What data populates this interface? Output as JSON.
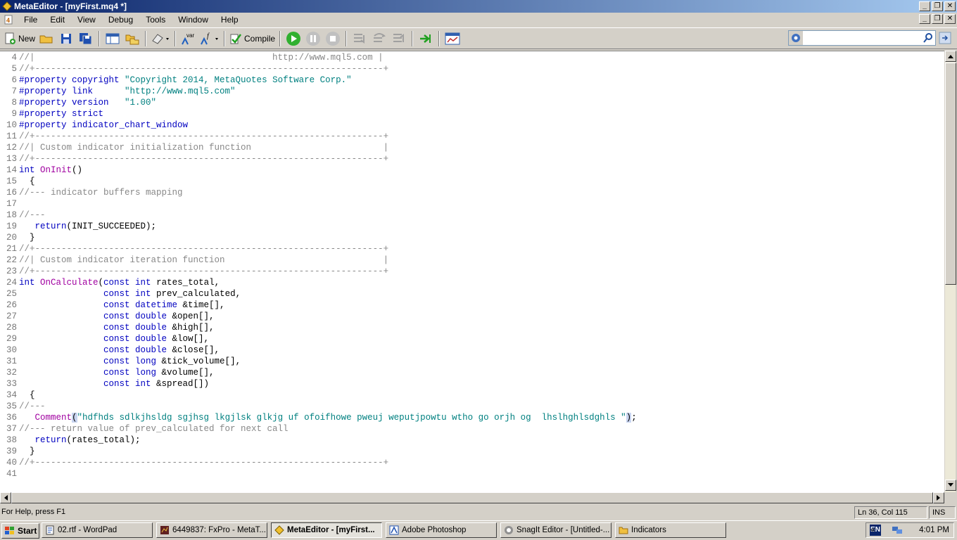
{
  "window": {
    "title": "MetaEditor - [myFirst.mq4 *]"
  },
  "menu": [
    "File",
    "Edit",
    "View",
    "Debug",
    "Tools",
    "Window",
    "Help"
  ],
  "toolbar": {
    "new_label": "New",
    "compile_label": "Compile",
    "var_label": "var",
    "search_value": ""
  },
  "editor": {
    "lines": [
      {
        "n": "4",
        "t": [
          [
            "cm",
            "//|                                             http://www.mql5.com |"
          ]
        ]
      },
      {
        "n": "5",
        "t": [
          [
            "cm",
            "//+------------------------------------------------------------------+"
          ]
        ]
      },
      {
        "n": "6",
        "t": [
          [
            "kw",
            "#property copyright "
          ],
          [
            "str",
            "\"Copyright 2014, MetaQuotes Software Corp.\""
          ]
        ]
      },
      {
        "n": "7",
        "t": [
          [
            "kw",
            "#property link      "
          ],
          [
            "str",
            "\"http://www.mql5.com\""
          ]
        ]
      },
      {
        "n": "8",
        "t": [
          [
            "kw",
            "#property version   "
          ],
          [
            "str",
            "\"1.00\""
          ]
        ]
      },
      {
        "n": "9",
        "t": [
          [
            "kw",
            "#property strict"
          ]
        ]
      },
      {
        "n": "10",
        "t": [
          [
            "kw",
            "#property indicator_chart_window"
          ]
        ]
      },
      {
        "n": "11",
        "t": [
          [
            "cm",
            "//+------------------------------------------------------------------+"
          ]
        ]
      },
      {
        "n": "12",
        "t": [
          [
            "cm",
            "//| Custom indicator initialization function                         |"
          ]
        ]
      },
      {
        "n": "13",
        "t": [
          [
            "cm",
            "//+------------------------------------------------------------------+"
          ]
        ]
      },
      {
        "n": "14",
        "t": [
          [
            "kw",
            "int "
          ],
          [
            "fn",
            "OnInit"
          ],
          [
            "tx",
            "()"
          ]
        ]
      },
      {
        "n": "15",
        "t": [
          [
            "tx",
            "  {"
          ]
        ]
      },
      {
        "n": "16",
        "t": [
          [
            "cm",
            "//--- indicator buffers mapping"
          ]
        ]
      },
      {
        "n": "17",
        "t": [
          [
            "tx",
            ""
          ]
        ]
      },
      {
        "n": "18",
        "t": [
          [
            "cm",
            "//---"
          ]
        ]
      },
      {
        "n": "19",
        "t": [
          [
            "kw",
            "   return"
          ],
          [
            "tx",
            "(INIT_SUCCEEDED);"
          ]
        ]
      },
      {
        "n": "20",
        "t": [
          [
            "tx",
            "  }"
          ]
        ]
      },
      {
        "n": "21",
        "t": [
          [
            "cm",
            "//+------------------------------------------------------------------+"
          ]
        ]
      },
      {
        "n": "22",
        "t": [
          [
            "cm",
            "//| Custom indicator iteration function                              |"
          ]
        ]
      },
      {
        "n": "23",
        "t": [
          [
            "cm",
            "//+------------------------------------------------------------------+"
          ]
        ]
      },
      {
        "n": "24",
        "t": [
          [
            "kw",
            "int "
          ],
          [
            "fn",
            "OnCalculate"
          ],
          [
            "tx",
            "("
          ],
          [
            "kw",
            "const int "
          ],
          [
            "tx",
            "rates_total,"
          ]
        ]
      },
      {
        "n": "25",
        "t": [
          [
            "kw",
            "                const int "
          ],
          [
            "tx",
            "prev_calculated,"
          ]
        ]
      },
      {
        "n": "26",
        "t": [
          [
            "kw",
            "                const datetime "
          ],
          [
            "tx",
            "&time[],"
          ]
        ]
      },
      {
        "n": "27",
        "t": [
          [
            "kw",
            "                const double "
          ],
          [
            "tx",
            "&open[],"
          ]
        ]
      },
      {
        "n": "28",
        "t": [
          [
            "kw",
            "                const double "
          ],
          [
            "tx",
            "&high[],"
          ]
        ]
      },
      {
        "n": "29",
        "t": [
          [
            "kw",
            "                const double "
          ],
          [
            "tx",
            "&low[],"
          ]
        ]
      },
      {
        "n": "30",
        "t": [
          [
            "kw",
            "                const double "
          ],
          [
            "tx",
            "&close[],"
          ]
        ]
      },
      {
        "n": "31",
        "t": [
          [
            "kw",
            "                const long "
          ],
          [
            "tx",
            "&tick_volume[],"
          ]
        ]
      },
      {
        "n": "32",
        "t": [
          [
            "kw",
            "                const long "
          ],
          [
            "tx",
            "&volume[],"
          ]
        ]
      },
      {
        "n": "33",
        "t": [
          [
            "kw",
            "                const int "
          ],
          [
            "tx",
            "&spread[])"
          ]
        ]
      },
      {
        "n": "34",
        "t": [
          [
            "tx",
            "  {"
          ]
        ]
      },
      {
        "n": "35",
        "t": [
          [
            "cm",
            "//---"
          ]
        ]
      },
      {
        "n": "36",
        "t": [
          [
            "fn",
            "   Comment"
          ],
          [
            "hl",
            "("
          ],
          [
            "str",
            "\"hdfhds sdlkjhsldg sgjhsg lkgjlsk glkjg uf ofoifhowe pweuj weputjpowtu wtho go orjh og  lhslhghlsdghls \""
          ],
          [
            "hl",
            ")"
          ],
          [
            "tx",
            ";"
          ]
        ]
      },
      {
        "n": "37",
        "t": [
          [
            "cm",
            "//--- return value of prev_calculated for next call"
          ]
        ]
      },
      {
        "n": "38",
        "t": [
          [
            "kw",
            "   return"
          ],
          [
            "tx",
            "(rates_total);"
          ]
        ]
      },
      {
        "n": "39",
        "t": [
          [
            "tx",
            "  }"
          ]
        ]
      },
      {
        "n": "40",
        "t": [
          [
            "cm",
            "//+------------------------------------------------------------------+"
          ]
        ]
      },
      {
        "n": "41",
        "t": [
          [
            "tx",
            ""
          ]
        ]
      }
    ]
  },
  "status": {
    "help": "For Help, press F1",
    "position": "Ln 36, Col 115",
    "mode": "INS"
  },
  "taskbar": {
    "start_label": "Start",
    "tasks": [
      {
        "label": "02.rtf - WordPad",
        "active": false
      },
      {
        "label": "6449837: FxPro - MetaT...",
        "active": false
      },
      {
        "label": "MetaEditor - [myFirst...",
        "active": true
      },
      {
        "label": "Adobe Photoshop",
        "active": false
      },
      {
        "label": "SnagIt Editor - [Untitled-...",
        "active": false
      },
      {
        "label": "Indicators",
        "active": false
      }
    ],
    "language": "EN",
    "clock": "4:01 PM"
  }
}
